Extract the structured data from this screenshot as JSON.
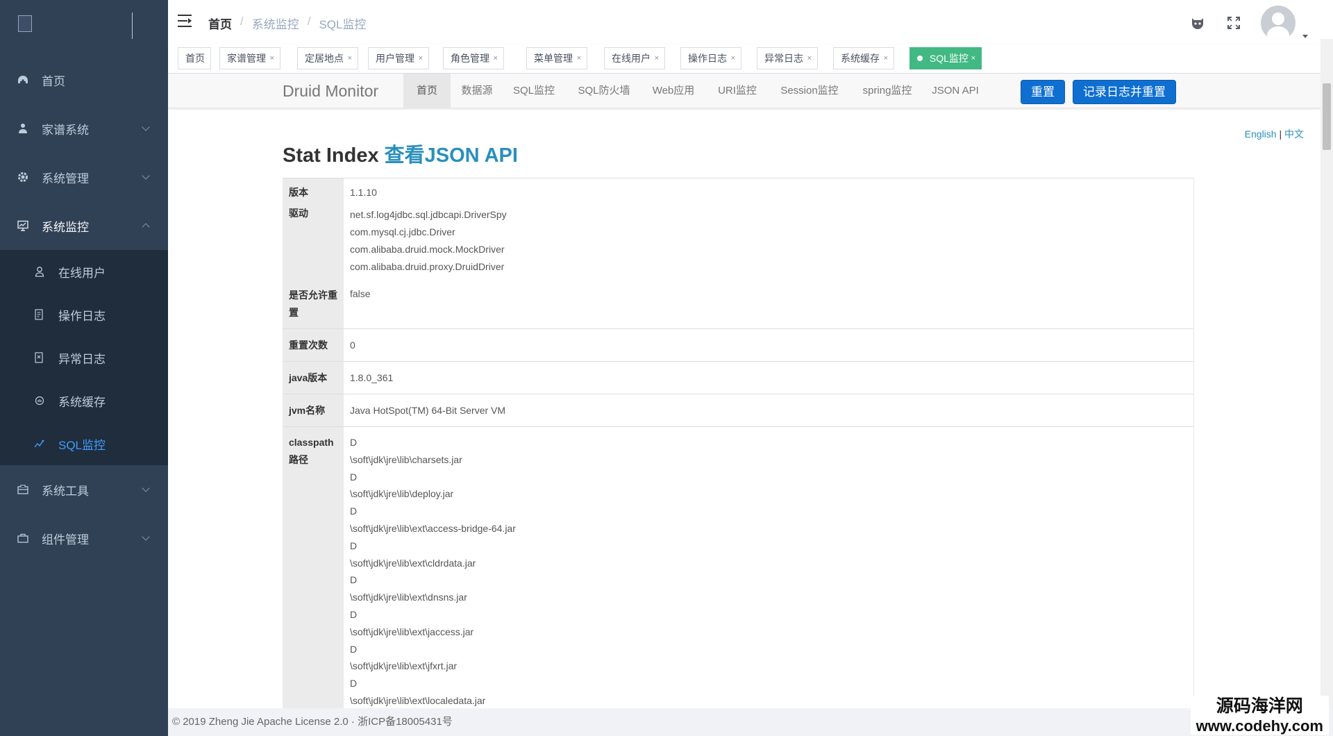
{
  "sidebar": {
    "menu": [
      {
        "label": "首页",
        "icon": "dashboard-icon"
      },
      {
        "label": "家谱系统",
        "icon": "user-tree-icon"
      },
      {
        "label": "系统管理",
        "icon": "gear-icon"
      },
      {
        "label": "系统监控",
        "icon": "monitor-icon"
      }
    ],
    "submenu": [
      {
        "label": "在线用户",
        "icon": "online-user-icon"
      },
      {
        "label": "操作日志",
        "icon": "log-icon"
      },
      {
        "label": "异常日志",
        "icon": "error-log-icon"
      },
      {
        "label": "系统缓存",
        "icon": "cache-icon"
      },
      {
        "label": "SQL监控",
        "icon": "sql-icon"
      }
    ],
    "menu_after": [
      {
        "label": "系统工具",
        "icon": "tool-icon"
      },
      {
        "label": "组件管理",
        "icon": "component-icon"
      }
    ]
  },
  "navbar": {
    "breadcrumb": [
      "首页",
      "系统监控",
      "SQL监控"
    ],
    "icons": [
      "github-icon",
      "fullscreen-icon"
    ]
  },
  "tags": [
    {
      "label": "首页",
      "close": ""
    },
    {
      "label": "家谱管理",
      "close": "×"
    },
    {
      "label": "定居地点",
      "close": "×"
    },
    {
      "label": "用户管理",
      "close": "×"
    },
    {
      "label": "角色管理",
      "close": "×"
    },
    {
      "label": "菜单管理",
      "close": "×"
    },
    {
      "label": "在线用户",
      "close": "×"
    },
    {
      "label": "操作日志",
      "close": "×"
    },
    {
      "label": "异常日志",
      "close": "×"
    },
    {
      "label": "系统缓存",
      "close": "×"
    },
    {
      "label": "SQL监控",
      "close": "×"
    }
  ],
  "druid": {
    "brand": "Druid Monitor",
    "nav": [
      "首页",
      "数据源",
      "SQL监控",
      "SQL防火墙",
      "Web应用",
      "URI监控",
      "Session监控",
      "spring监控",
      "JSON API"
    ],
    "reset_label": "重置",
    "log_reset_label": "记录日志并重置",
    "lang_en": "English",
    "lang_sep": "|",
    "lang_zh": "中文",
    "title": "Stat Index",
    "title_link": "查看JSON API",
    "table": {
      "version_label": "版本",
      "version": "1.1.10",
      "driver_label": "驱动",
      "drivers": [
        "net.sf.log4jdbc.sql.jdbcapi.DriverSpy",
        "com.mysql.cj.jdbc.Driver",
        "com.alibaba.druid.mock.MockDriver",
        "com.alibaba.druid.proxy.DruidDriver"
      ],
      "reset_enable_label": "是否允许重置",
      "reset_enable": "false",
      "reset_count_label": "重置次数",
      "reset_count": "0",
      "java_version_label": "java版本",
      "java_version": "1.8.0_361",
      "jvm_name_label": "jvm名称",
      "jvm_name": "Java HotSpot(TM) 64-Bit Server VM",
      "classpath_label": "classpath路径",
      "classpath": [
        "D",
        "\\soft\\jdk\\jre\\lib\\charsets.jar",
        "D",
        "\\soft\\jdk\\jre\\lib\\deploy.jar",
        "D",
        "\\soft\\jdk\\jre\\lib\\ext\\access-bridge-64.jar",
        "D",
        "\\soft\\jdk\\jre\\lib\\ext\\cldrdata.jar",
        "D",
        "\\soft\\jdk\\jre\\lib\\ext\\dnsns.jar",
        "D",
        "\\soft\\jdk\\jre\\lib\\ext\\jaccess.jar",
        "D",
        "\\soft\\jdk\\jre\\lib\\ext\\jfxrt.jar",
        "D",
        "\\soft\\jdk\\jre\\lib\\ext\\localedata.jar"
      ]
    }
  },
  "footer": "© 2019 Zheng Jie Apache License 2.0 · 浙ICP备18005431号",
  "watermark": {
    "line1": "源码海洋网",
    "line2": "www.codehy.com"
  }
}
